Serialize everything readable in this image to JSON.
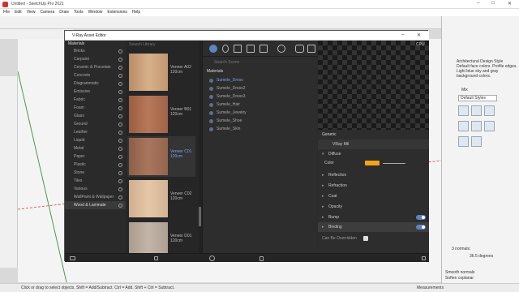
{
  "app": {
    "title": "Untitled - SketchUp Pro 2021",
    "menu": [
      "File",
      "Edit",
      "View",
      "Camera",
      "Draw",
      "Tools",
      "Window",
      "Extensions",
      "Help"
    ],
    "status": "Click or drag to select objects. Shift = Add/Subtract. Ctrl = Add. Shift + Ctrl = Subtract.",
    "measurements_label": "Measurements"
  },
  "vray": {
    "title": "V-Ray Asset Editor",
    "categories_header": "Materials",
    "categories": [
      "Bricks",
      "Carpaint",
      "Ceramic & Porcelain",
      "Concrete",
      "Diagrammatic",
      "Emissive",
      "Fabric",
      "Foam",
      "Glass",
      "Ground",
      "Leather",
      "Liquid",
      "Metal",
      "Paper",
      "Plastic",
      "Stone",
      "Tiles",
      "Various",
      "WallPaint & Wallpaper",
      "Wood & Laminate"
    ],
    "selected_category": "Wood & Laminate",
    "library_search_placeholder": "Search Library",
    "thumbnails": [
      {
        "name": "Veneer A02\n120cm",
        "color": "#c49a73"
      },
      {
        "name": "Veneer B01\n120cm",
        "color": "#a6674a"
      },
      {
        "name": "Veneer C01\n120cm",
        "color": "#9b6a52"
      },
      {
        "name": "Veneer C02\n120cm",
        "color": "#d8b897"
      },
      {
        "name": "Veneer D01\n120cm",
        "color": "#b7a89a"
      }
    ],
    "selected_thumbnail": "Veneer C01",
    "scene_search_placeholder": "Search Scene",
    "scene_header": "Materials",
    "scene_materials": [
      "Sumele_Dress",
      "Sumele_Dress2",
      "Sumele_Dress3",
      "Sumele_Hair",
      "Sumele_Jewelry",
      "Sumele_Shoe",
      "Sumele_Skin"
    ],
    "selected_scene_material": "Sumele_Dress",
    "cpu_label": "CPU",
    "props": {
      "generic": "Generic",
      "material_type": "VRay Mtl",
      "diffuse": "Diffuse",
      "color_label": "Color",
      "color_swatch": "#f4a316",
      "sections": [
        "Reflection",
        "Refraction",
        "Coat",
        "Opacity",
        "Bump",
        "Binding"
      ],
      "can_be_overridden": "Can Be Overridden"
    }
  },
  "tray": {
    "desc": "Architectural Design Style\nDefault face colors. Profile edges. Light blue sky and gray background colors.",
    "mix": "Mix",
    "styles_select": "Default Styles",
    "fog_color": "3 normals:",
    "angle_value": "36.5  degrees",
    "smooth_normals": "Smooth normals",
    "soften_coplanar": "Soften coplanar"
  }
}
